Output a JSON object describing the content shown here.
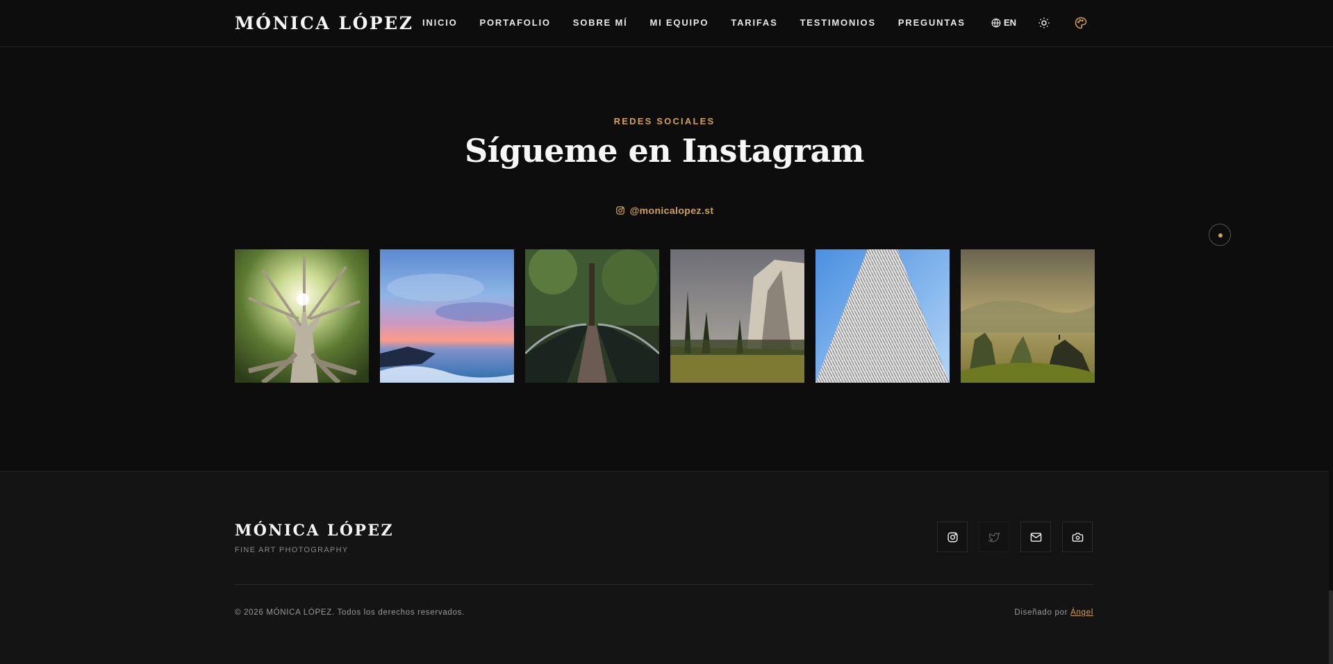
{
  "header": {
    "logo": "MÓNICA LÓPEZ",
    "nav": [
      "INICIO",
      "PORTAFOLIO",
      "SOBRE MÍ",
      "MI EQUIPO",
      "TARIFAS",
      "TESTIMONIOS",
      "PREGUNTAS"
    ],
    "lang_label": "EN",
    "icons": {
      "lang": "globe-icon",
      "theme": "sun-icon",
      "palette": "palette-icon"
    }
  },
  "section": {
    "eyebrow": "REDES SOCIALES",
    "title": "Sígueme en Instagram",
    "handle": "@monicalopez.st",
    "handle_icon": "instagram-icon",
    "gallery": [
      {
        "name": "photo-tree",
        "icon": "image-icon"
      },
      {
        "name": "photo-seascape",
        "icon": "image-icon"
      },
      {
        "name": "photo-bridge",
        "icon": "image-icon"
      },
      {
        "name": "photo-cliff",
        "icon": "image-icon"
      },
      {
        "name": "photo-skyscraper",
        "icon": "image-icon"
      },
      {
        "name": "photo-valley",
        "icon": "image-icon"
      }
    ]
  },
  "footer": {
    "logo": "MÓNICA LÓPEZ",
    "tagline": "FINE ART PHOTOGRAPHY",
    "socials": [
      "instagram-icon",
      "twitter-icon",
      "mail-icon",
      "camera-icon"
    ],
    "copyright": "© 2026 MÓNICA LÓPEZ. Todos los derechos reservados.",
    "credit_prefix": "Diseñado por",
    "credit_link": "Ángel"
  },
  "colors": {
    "accent": "#d4a24c",
    "background": "#0d0d0d",
    "footer_bg": "#141414",
    "text": "#f2f2f2"
  }
}
